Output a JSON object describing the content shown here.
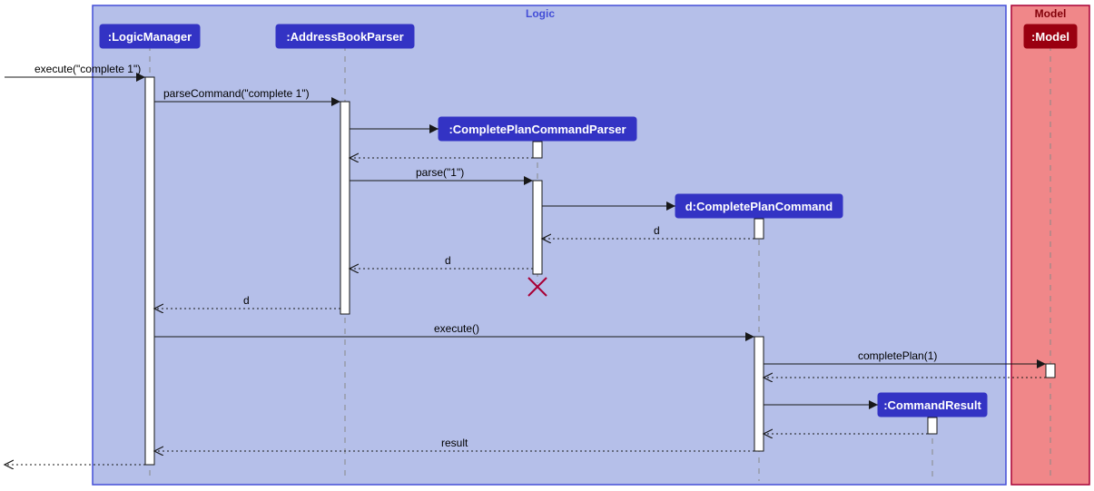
{
  "frames": {
    "logic": {
      "label": "Logic"
    },
    "model": {
      "label": "Model"
    }
  },
  "participants": {
    "logicManager": {
      "label": ":LogicManager"
    },
    "addressBookParser": {
      "label": ":AddressBookParser"
    },
    "completeParser": {
      "label": ":CompletePlanCommandParser"
    },
    "completeCommand": {
      "label": "d:CompletePlanCommand"
    },
    "commandResult": {
      "label": ":CommandResult"
    },
    "model": {
      "label": ":Model"
    }
  },
  "messages": {
    "m1": "execute(\"complete 1\")",
    "m2": "parseCommand(\"complete 1\")",
    "m3": "parse(\"1\")",
    "m4": "d",
    "m5": "d",
    "m6": "d",
    "m7": "execute()",
    "m8": "completePlan(1)",
    "m9": "result"
  },
  "chart_data": {
    "type": "sequence-diagram",
    "frames": [
      {
        "name": "Logic",
        "participants": [
          "LogicManager",
          "AddressBookParser",
          "CompletePlanCommandParser",
          "d:CompletePlanCommand",
          "CommandResult"
        ]
      },
      {
        "name": "Model",
        "participants": [
          "Model"
        ]
      }
    ],
    "participants": [
      "LogicManager",
      "AddressBookParser",
      "CompletePlanCommandParser",
      "d:CompletePlanCommand",
      "CommandResult",
      "Model"
    ],
    "events": [
      {
        "from": "external",
        "to": "LogicManager",
        "label": "execute(\"complete 1\")",
        "type": "call",
        "activates": "LogicManager"
      },
      {
        "from": "LogicManager",
        "to": "AddressBookParser",
        "label": "parseCommand(\"complete 1\")",
        "type": "call",
        "activates": "AddressBookParser"
      },
      {
        "from": "AddressBookParser",
        "to": "CompletePlanCommandParser",
        "label": "",
        "type": "create",
        "activates": "CompletePlanCommandParser"
      },
      {
        "from": "CompletePlanCommandParser",
        "to": "AddressBookParser",
        "label": "",
        "type": "return"
      },
      {
        "from": "AddressBookParser",
        "to": "CompletePlanCommandParser",
        "label": "parse(\"1\")",
        "type": "call",
        "activates": "CompletePlanCommandParser"
      },
      {
        "from": "CompletePlanCommandParser",
        "to": "d:CompletePlanCommand",
        "label": "",
        "type": "create",
        "activates": "d:CompletePlanCommand"
      },
      {
        "from": "d:CompletePlanCommand",
        "to": "CompletePlanCommandParser",
        "label": "d",
        "type": "return"
      },
      {
        "from": "CompletePlanCommandParser",
        "to": "AddressBookParser",
        "label": "d",
        "type": "return",
        "destroys": "CompletePlanCommandParser"
      },
      {
        "from": "AddressBookParser",
        "to": "LogicManager",
        "label": "d",
        "type": "return",
        "deactivates": "AddressBookParser"
      },
      {
        "from": "LogicManager",
        "to": "d:CompletePlanCommand",
        "label": "execute()",
        "type": "call",
        "activates": "d:CompletePlanCommand"
      },
      {
        "from": "d:CompletePlanCommand",
        "to": "Model",
        "label": "completePlan(1)",
        "type": "call",
        "activates": "Model"
      },
      {
        "from": "Model",
        "to": "d:CompletePlanCommand",
        "label": "",
        "type": "return",
        "deactivates": "Model"
      },
      {
        "from": "d:CompletePlanCommand",
        "to": "CommandResult",
        "label": "",
        "type": "create",
        "activates": "CommandResult"
      },
      {
        "from": "CommandResult",
        "to": "d:CompletePlanCommand",
        "label": "",
        "type": "return"
      },
      {
        "from": "d:CompletePlanCommand",
        "to": "LogicManager",
        "label": "result",
        "type": "return",
        "deactivates": "d:CompletePlanCommand"
      },
      {
        "from": "LogicManager",
        "to": "external",
        "label": "",
        "type": "return",
        "deactivates": "LogicManager"
      }
    ]
  }
}
